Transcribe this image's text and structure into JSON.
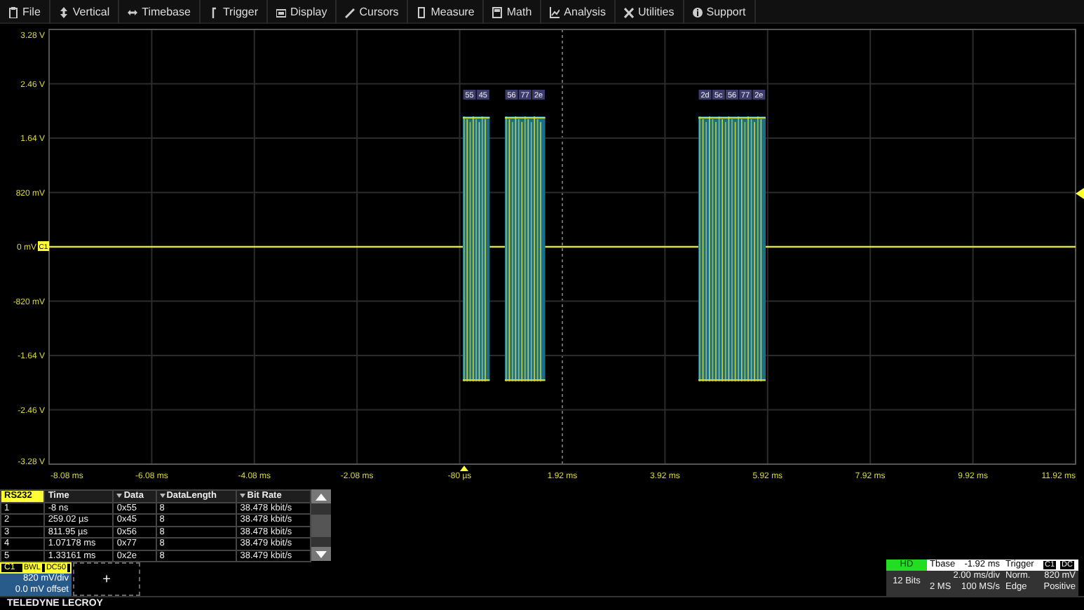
{
  "menu": [
    {
      "label": "File"
    },
    {
      "label": "Vertical"
    },
    {
      "label": "Timebase"
    },
    {
      "label": "Trigger"
    },
    {
      "label": "Display"
    },
    {
      "label": "Cursors"
    },
    {
      "label": "Measure"
    },
    {
      "label": "Math"
    },
    {
      "label": "Analysis"
    },
    {
      "label": "Utilities"
    },
    {
      "label": "Support"
    }
  ],
  "y_axis_labels": [
    "3.28 V",
    "2.46 V",
    "1.64 V",
    "820 mV",
    "0 mV",
    "-820 mV",
    "-1.64 V",
    "-2.46 V",
    "-3.28 V"
  ],
  "x_axis_labels": [
    "-8.08 ms",
    "-6.08 ms",
    "-4.08 ms",
    "-2.08 ms",
    "-80 µs",
    "1.92 ms",
    "3.92 ms",
    "5.92 ms",
    "7.92 ms",
    "9.92 ms",
    "11.92 ms"
  ],
  "channel_marker": "C1",
  "decode_frames": [
    {
      "bytes": [
        "55",
        "45"
      ]
    },
    {
      "bytes": [
        "56",
        "77",
        "2e"
      ]
    },
    {
      "bytes": [
        "2d",
        "5c",
        "56",
        "77",
        "2e"
      ]
    }
  ],
  "table": {
    "columns": [
      "RS232",
      "Time",
      "Data",
      "DataLength",
      "Bit Rate"
    ],
    "rows": [
      [
        "1",
        "-8 ns",
        "0x55",
        "8",
        "38.478 kbit/s"
      ],
      [
        "2",
        "259.02 µs",
        "0x45",
        "8",
        "38.478 kbit/s"
      ],
      [
        "3",
        "811.95 µs",
        "0x56",
        "8",
        "38.478 kbit/s"
      ],
      [
        "4",
        "1.07178 ms",
        "0x77",
        "8",
        "38.479 kbit/s"
      ],
      [
        "5",
        "1.33161 ms",
        "0x2e",
        "8",
        "38.479 kbit/s"
      ]
    ]
  },
  "channel": {
    "name": "C1",
    "badges": [
      "BWL",
      "DC50"
    ],
    "scale": "820 mV/div",
    "offset": "0.0 mV offset"
  },
  "add_button": "+",
  "acquisition": {
    "mode": "HD",
    "bits": "12 Bits"
  },
  "timebase": {
    "label": "Tbase",
    "delay": "-1.92 ms",
    "scale": "2.00 ms/div",
    "samples": "2 MS",
    "rate": "100 MS/s"
  },
  "trigger": {
    "label": "Trigger",
    "source": "C1",
    "coupling": "DC",
    "mode": "Norm.",
    "level": "820 mV",
    "type": "Edge",
    "slope": "Positive"
  },
  "brand": "TELEDYNE LECROY"
}
